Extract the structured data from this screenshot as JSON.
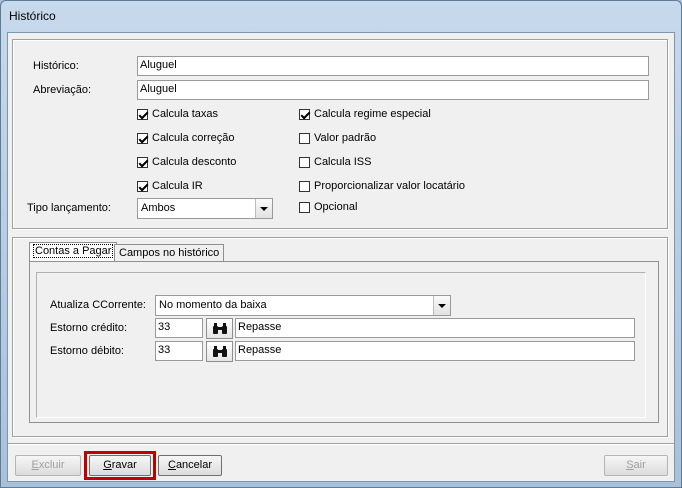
{
  "window": {
    "title": "Histórico"
  },
  "form": {
    "historico_label": "Histórico:",
    "historico_value": "Aluguel",
    "abreviacao_label": "Abreviação:",
    "abreviacao_value": "Aluguel",
    "tipo_label": "Tipo lançamento:",
    "tipo_value": "Ambos"
  },
  "checkboxes": {
    "left": [
      {
        "label": "Calcula taxas",
        "checked": true
      },
      {
        "label": "Calcula correção",
        "checked": true
      },
      {
        "label": "Calcula desconto",
        "checked": true
      },
      {
        "label": "Calcula IR",
        "checked": true
      }
    ],
    "right": [
      {
        "label": "Calcula regime especial",
        "checked": true
      },
      {
        "label": "Valor padrão",
        "checked": false
      },
      {
        "label": "Calcula ISS",
        "checked": false
      },
      {
        "label": "Proporcionalizar valor locatário",
        "checked": false
      },
      {
        "label": "Opcional",
        "checked": false
      }
    ]
  },
  "tabs": [
    {
      "label": "Contas a Pagar",
      "active": true
    },
    {
      "label": "Campos no histórico",
      "active": false
    }
  ],
  "contas": {
    "atualiza_label": "Atualiza CCorrente:",
    "atualiza_value": "No momento da baixa",
    "credito_label": "Estorno crédito:",
    "credito_code": "33",
    "credito_desc": "Repasse",
    "debito_label": "Estorno débito:",
    "debito_code": "33",
    "debito_desc": "Repasse"
  },
  "buttons": {
    "excluir": {
      "mnemonic": "E",
      "rest": "xcluir"
    },
    "gravar": {
      "mnemonic": "G",
      "rest": "ravar"
    },
    "cancelar": {
      "mnemonic": "C",
      "rest": "ancelar"
    },
    "sair": {
      "mnemonic": "S",
      "rest": "air"
    }
  },
  "icons": {
    "lookup": "binoculars-icon",
    "dropdown": "chevron-down-icon"
  },
  "colors": {
    "highlight": "#c00000",
    "title_bar": "#c7d9ec"
  }
}
